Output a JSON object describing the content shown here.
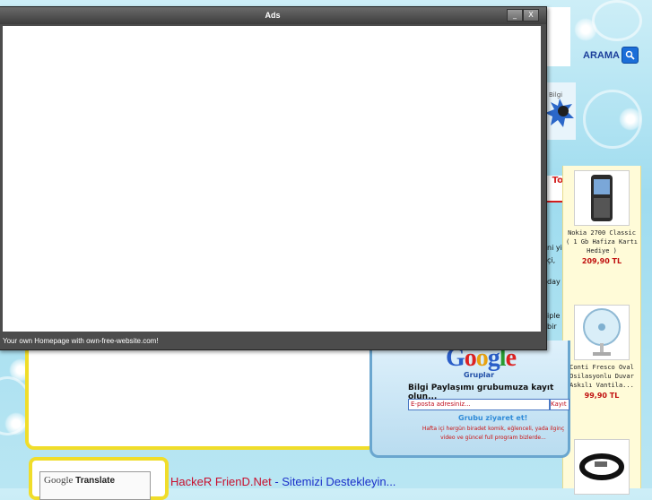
{
  "popup": {
    "title": "Ads",
    "footer_text": "Your own Homepage with own-free-website.com!",
    "minimize_label": "_",
    "close_label": "X"
  },
  "search": {
    "label": "ARAMA"
  },
  "badge": {
    "text": "Bilgi"
  },
  "tab_partial": "To",
  "behind_lines": [
    "ni yi",
    "çi,",
    "day",
    "iple",
    "bir"
  ],
  "products": [
    {
      "name": "Nokia 2700 Classic ( 1 Gb Hafiza Kartı Hediye )",
      "price": "209,90 TL",
      "icon": "phone-icon"
    },
    {
      "name": "Conti Fresco Oval Osilasyonlu Duvar Askılı Vantila...",
      "price": "99,90 TL",
      "icon": "fan-icon"
    },
    {
      "name": "",
      "price": "",
      "icon": "bracelet-icon"
    }
  ],
  "google_groups": {
    "logo_text": "Google",
    "sub": "Gruplar",
    "title": "Bilgi Paylaşımı grubumuza kayıt olun...",
    "email_placeholder": "E-posta adresiniz...",
    "button_label": "Kayıt",
    "visit": "Grubu ziyaret et!",
    "description": "Hafta içi hergün biradet komik, eğlenceli, yada ilginç video ve güncel full program bizlerde..."
  },
  "translate": {
    "google": "Google",
    "label": "Translate"
  },
  "support": {
    "site": "HackeR FrienD.Net",
    "sep": " - ",
    "text": "Sitemizi Destekleyin..."
  },
  "colors": {
    "accent_red": "#c8102e",
    "link_blue": "#1a2fc9",
    "frame_yellow": "#f0dd2a"
  }
}
